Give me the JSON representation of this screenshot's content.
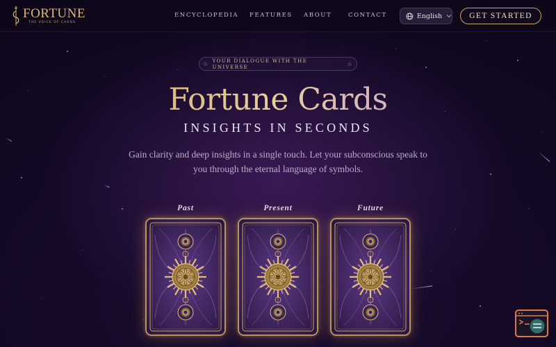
{
  "brand": {
    "name": "FORTUNE",
    "tagline": "THE VOICE OF CARDS"
  },
  "nav": {
    "items": [
      "ENCYCLOPEDIA",
      "FEATURES",
      "ABOUT",
      "CONTACT"
    ],
    "language": "English",
    "cta": "GET STARTED"
  },
  "hero": {
    "badge": "YOUR DIALOGUE WITH THE UNIVERSE",
    "title": "Fortune Cards",
    "subtitle": "INSIGHTS IN SECONDS",
    "description": "Gain clarity and deep insights in a single touch. Let your subconscious speak to you through the eternal language of symbols."
  },
  "cards": [
    {
      "label": "Past"
    },
    {
      "label": "Present"
    },
    {
      "label": "Future"
    }
  ],
  "colors": {
    "gold": "#d9b874",
    "lavender": "#c9a4cf",
    "accent_orange": "#e0794a"
  },
  "icons": [
    "logo-mark-icon",
    "globe-icon",
    "chevron-down-icon",
    "sparkle-icon",
    "assistant-widget-icon"
  ]
}
